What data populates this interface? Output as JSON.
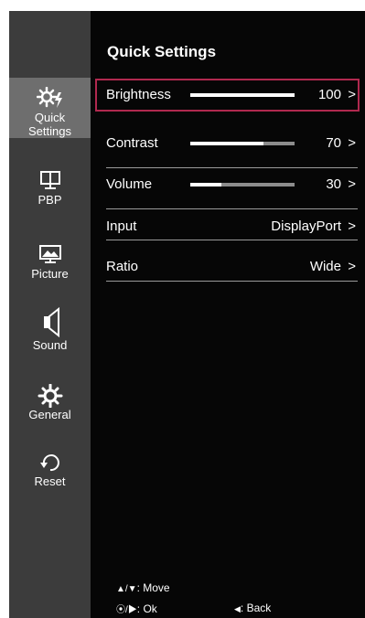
{
  "panel": {
    "title": "Quick Settings"
  },
  "sidebar": {
    "items": [
      {
        "label": "Quick\nSettings",
        "icon": "quick-settings-icon",
        "active": true
      },
      {
        "label": "PBP",
        "icon": "pbp-icon",
        "active": false
      },
      {
        "label": "Picture",
        "icon": "picture-icon",
        "active": false
      },
      {
        "label": "Sound",
        "icon": "speaker-icon",
        "active": false
      },
      {
        "label": "General",
        "icon": "gear-icon",
        "active": false
      },
      {
        "label": "Reset",
        "icon": "reset-icon",
        "active": false
      }
    ]
  },
  "settings": {
    "brightness": {
      "label": "Brightness",
      "value": "100",
      "level": 1.0,
      "chevron": ">"
    },
    "contrast": {
      "label": "Contrast",
      "value": "70",
      "level": 0.7,
      "chevron": ">"
    },
    "volume": {
      "label": "Volume",
      "value": "30",
      "level": 0.3,
      "chevron": ">"
    },
    "input": {
      "label": "Input",
      "value": "DisplayPort",
      "chevron": ">"
    },
    "ratio": {
      "label": "Ratio",
      "value": "Wide",
      "chevron": ">"
    }
  },
  "hints": {
    "move_keys": "▲/▼",
    "move_label": ": Move",
    "ok_keys": "⦿/▶",
    "ok_label": ": Ok",
    "back_key": "◀",
    "back_label": ": Back"
  },
  "colors": {
    "background": "#060606",
    "sidebar": "#3c3c3c",
    "sidebar_active": "#6e6e6e",
    "selection_outline": "#b0294f",
    "slider_track": "#8c8c8c",
    "slider_fill": "#ffffff"
  }
}
